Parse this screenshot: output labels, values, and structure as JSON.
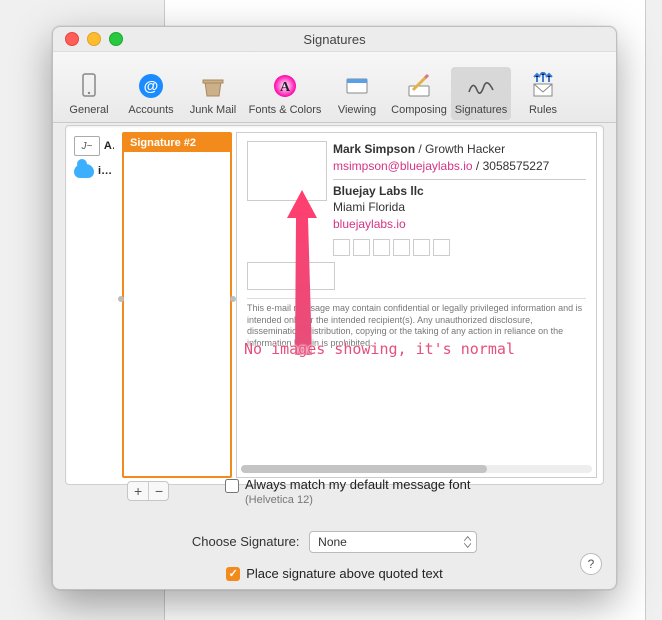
{
  "window": {
    "title": "Signatures"
  },
  "toolbar": {
    "items": [
      {
        "label": "General"
      },
      {
        "label": "Accounts"
      },
      {
        "label": "Junk Mail"
      },
      {
        "label": "Fonts & Colors"
      },
      {
        "label": "Viewing"
      },
      {
        "label": "Composing"
      },
      {
        "label": "Signatures"
      },
      {
        "label": "Rules"
      }
    ],
    "selected": "Signatures"
  },
  "accounts": {
    "items": [
      {
        "label": "Al"
      },
      {
        "label": "i…"
      }
    ]
  },
  "signature_list": {
    "items": [
      "Signature #2"
    ],
    "selected_index": 0
  },
  "signature": {
    "name": "Mark Simpson",
    "role": "Growth Hacker",
    "email": "msimpson@bluejaylabs.io",
    "phone": "3058575227",
    "company": "Bluejay Labs llc",
    "location": "Miami Florida",
    "website": "bluejaylabs.io",
    "disclaimer": "This e-mail message may contain confidential or legally privileged information and is intended only for the intended recipient(s). Any unauthorized disclosure, dissemination, distribution, copying or the taking of any action in reliance on the information herein is prohibited."
  },
  "controls": {
    "add": "+",
    "remove": "−"
  },
  "options": {
    "match_font_label": "Always match my default message font",
    "match_font_sub": "(Helvetica 12)",
    "match_font_checked": false,
    "choose_label": "Choose Signature:",
    "choose_value": "None",
    "place_above_label": "Place signature above quoted text",
    "place_above_checked": true
  },
  "annotation": {
    "text": "No images showing, it's normal"
  },
  "colors": {
    "accent_orange": "#f28b1c",
    "link_pink": "#d63384",
    "annotation_pink": "#e64f7b"
  }
}
